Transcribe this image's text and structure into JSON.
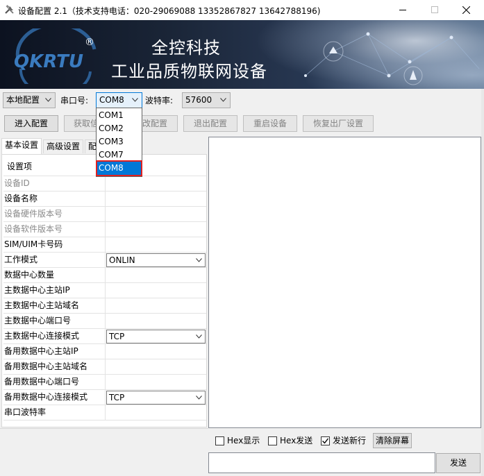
{
  "window": {
    "title": "设备配置 2.1（技术支持电话：020-29069088 13352867827 13642788196)",
    "icon": "tools-icon",
    "controls": [
      "minimize-icon",
      "maximize-icon",
      "close-icon"
    ]
  },
  "banner": {
    "logo_text": "QKRTU",
    "registered_mark": "®",
    "brand": "全控科技",
    "slogan": "工业品质物联网设备"
  },
  "toolbar": {
    "mode_select": "本地配置",
    "port_label": "串口号:",
    "port_value": "COM8",
    "baud_label": "波特率:",
    "baud_value": "57600",
    "buttons": {
      "enter": "进入配置",
      "get": "获取信",
      "modify": "改配置",
      "exit": "退出配置",
      "restart": "重启设备",
      "reset": "恢复出厂设置"
    }
  },
  "port_dropdown": {
    "options": [
      "COM1",
      "COM2",
      "COM3",
      "COM7",
      "COM8"
    ],
    "selected": "COM8",
    "highlight_color": "#0078d7",
    "outline_color": "#e02020"
  },
  "tabs": [
    "基本设置",
    "高级设置",
    "配"
  ],
  "grid": {
    "header": "设置项",
    "rows": [
      {
        "key": "设备ID",
        "value": ""
      },
      {
        "key": "设备名称",
        "value": ""
      },
      {
        "key": "设备硬件版本号",
        "value": ""
      },
      {
        "key": "设备软件版本号",
        "value": ""
      },
      {
        "key": "SIM/UIM卡号码",
        "value": ""
      },
      {
        "key": "工作模式",
        "value": "ONLIN"
      },
      {
        "key": "数据中心数量",
        "value": ""
      },
      {
        "key": "主数据中心主站IP",
        "value": ""
      },
      {
        "key": "主数据中心主站域名",
        "value": ""
      },
      {
        "key": "主数据中心端口号",
        "value": ""
      },
      {
        "key": "主数据中心连接模式",
        "value": "TCP"
      },
      {
        "key": "备用数据中心主站IP",
        "value": ""
      },
      {
        "key": "备用数据中心主站域名",
        "value": ""
      },
      {
        "key": "备用数据中心端口号",
        "value": ""
      },
      {
        "key": "备用数据中心连接模式",
        "value": "TCP"
      },
      {
        "key": "串口波特率",
        "value": ""
      }
    ]
  },
  "serial": {
    "hex_display": {
      "label": "Hex显示",
      "checked": false
    },
    "hex_send": {
      "label": "Hex发送",
      "checked": false
    },
    "send_newline": {
      "label": "发送新行",
      "checked": true
    },
    "clear_label": "清除屏幕",
    "send_label": "发送"
  }
}
